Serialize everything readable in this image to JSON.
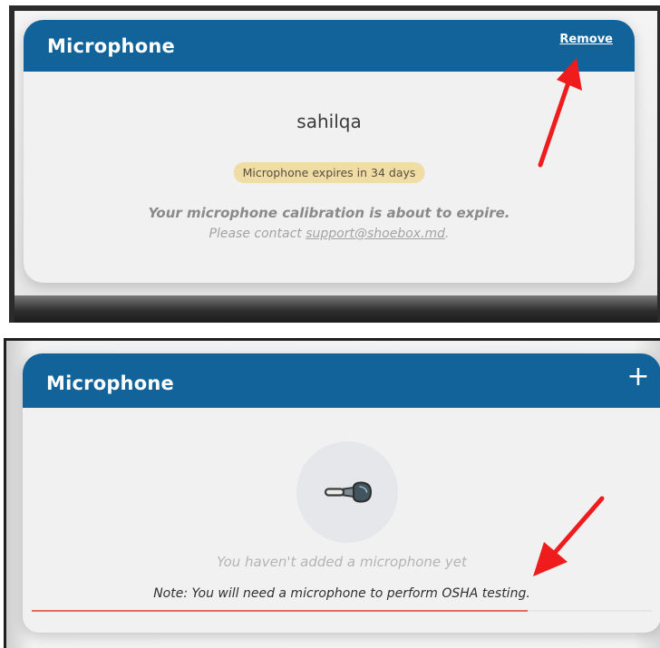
{
  "top_panel": {
    "card_title": "Microphone",
    "remove_label": "Remove",
    "device_name": "sahilqa",
    "expiry_badge": "Microphone expires in 34 days",
    "warning_text": "Your microphone calibration is about to expire.",
    "contact_prefix": "Please contact ",
    "support_email": "support@shoebox.md",
    "contact_suffix": "."
  },
  "bottom_panel": {
    "card_title": "Microphone",
    "add_symbol": "+",
    "empty_text": "You haven't added a microphone yet",
    "note_text": "Note: You will need a microphone to perform OSHA testing.",
    "progress_fraction": 0.8
  },
  "colors": {
    "header_blue": "#12639a",
    "badge_bg": "#f0dca5",
    "annotation_red": "#ee1c1c",
    "progress_red": "#e06e5a"
  },
  "icons": {
    "microphone": "microphone-icon",
    "arrow": "red-arrow-annotation"
  }
}
